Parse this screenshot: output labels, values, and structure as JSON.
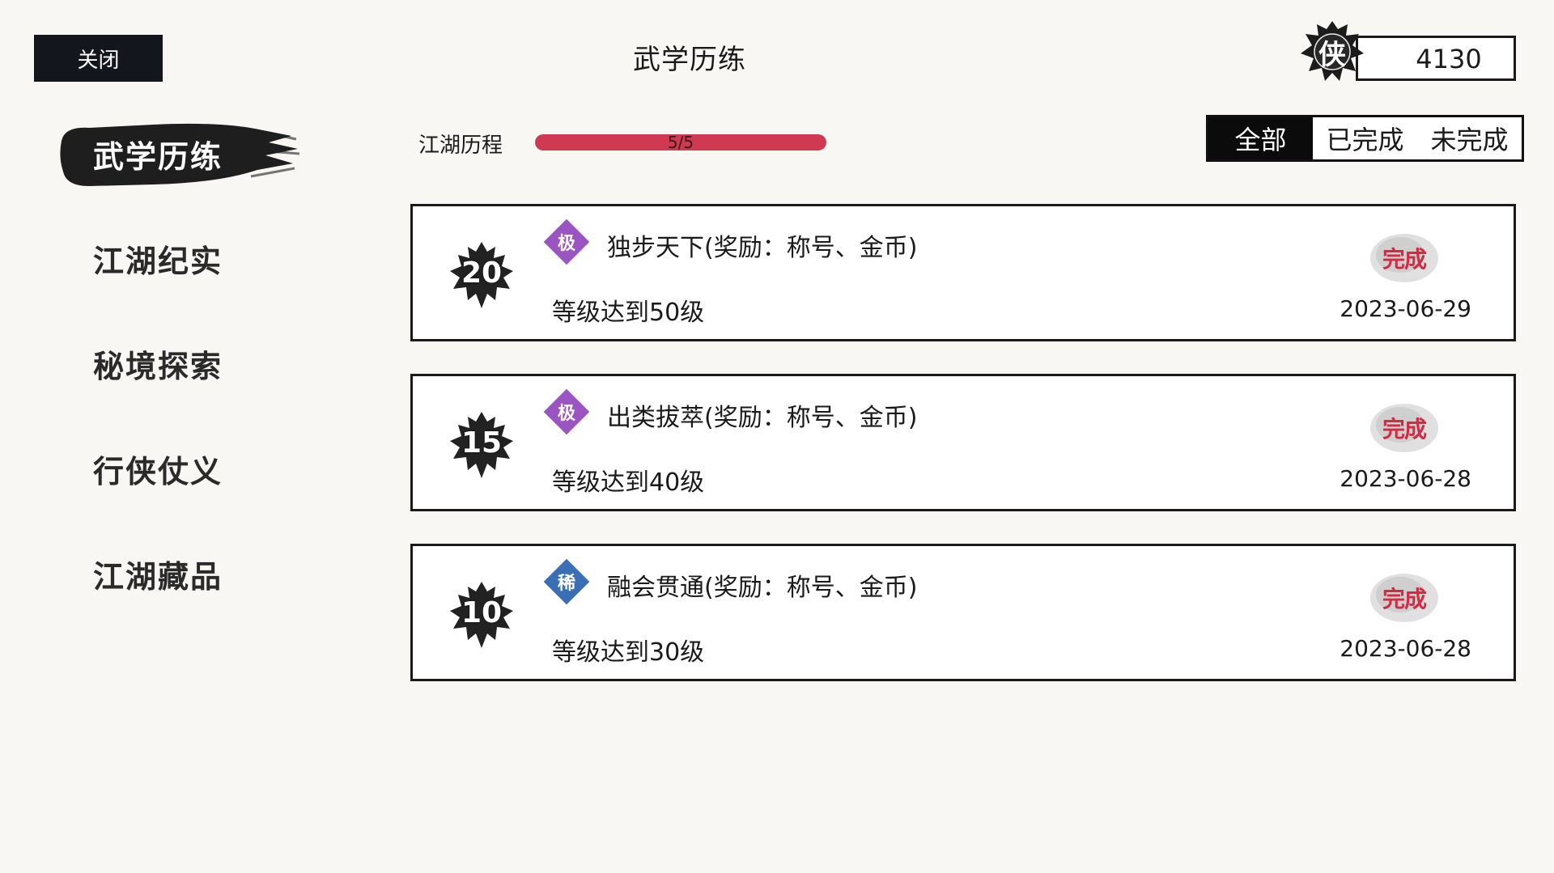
{
  "header": {
    "close_label": "关闭",
    "title": "武学历练",
    "currency_icon_char": "侠",
    "currency_value": "4130"
  },
  "sidebar": {
    "items": [
      {
        "label": "武学历练",
        "active": true
      },
      {
        "label": "江湖纪实",
        "active": false
      },
      {
        "label": "秘境探索",
        "active": false
      },
      {
        "label": "行侠仗义",
        "active": false
      },
      {
        "label": "江湖藏品",
        "active": false
      }
    ]
  },
  "progress": {
    "label": "江湖历程",
    "text": "5/5",
    "fraction": 1.0
  },
  "filters": {
    "tabs": [
      {
        "label": "全部",
        "active": true
      },
      {
        "label": "已完成",
        "active": false
      },
      {
        "label": "未完成",
        "active": false
      }
    ]
  },
  "achievements": [
    {
      "level": "20",
      "rarity": "极",
      "rarity_color": "#9b55c2",
      "title": "独步天下(奖励：称号、金币)",
      "condition": "等级达到50级",
      "status": "完成",
      "date": "2023-06-29"
    },
    {
      "level": "15",
      "rarity": "极",
      "rarity_color": "#9b55c2",
      "title": "出类拔萃(奖励：称号、金币)",
      "condition": "等级达到40级",
      "status": "完成",
      "date": "2023-06-28"
    },
    {
      "level": "10",
      "rarity": "稀",
      "rarity_color": "#3a6fb5",
      "title": "融会贯通(奖励：称号、金币)",
      "condition": "等级达到30级",
      "status": "完成",
      "date": "2023-06-28"
    }
  ],
  "colors": {
    "accent_progress": "#cf3a52",
    "stamp_red": "#d12c44",
    "dark": "#14161e"
  },
  "icons": {
    "currency": "xia-emblem-icon",
    "level_badge": "crest-badge-icon",
    "stamp": "complete-stamp-icon",
    "nav_active": "ink-brush-stroke"
  }
}
